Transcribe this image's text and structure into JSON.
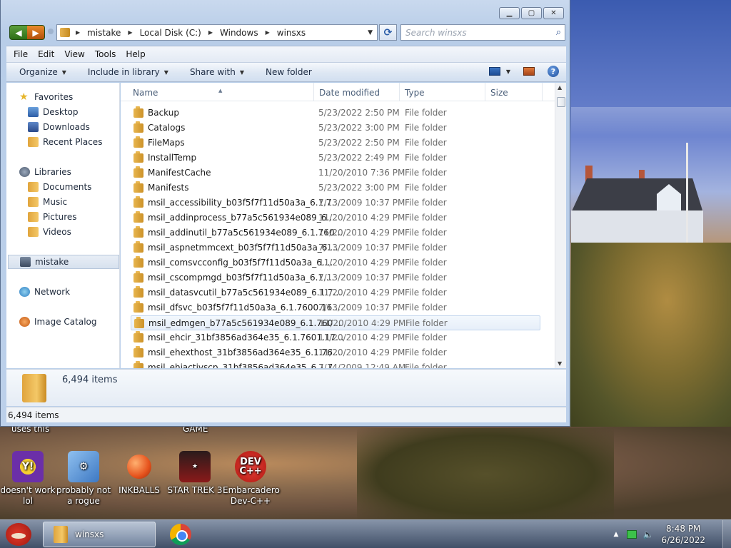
{
  "window": {
    "controls": {
      "minimize": "▭",
      "maximize": "▢",
      "close": "✕"
    }
  },
  "address_bar": {
    "crumbs": [
      "mistake",
      "Local Disk (C:)",
      "Windows",
      "winsxs"
    ]
  },
  "search": {
    "placeholder": "Search winsxs"
  },
  "menu": [
    "File",
    "Edit",
    "View",
    "Tools",
    "Help"
  ],
  "toolbar": {
    "organize": "Organize",
    "include_in_library": "Include in library",
    "share_with": "Share with",
    "new_folder": "New folder"
  },
  "navpane": {
    "favorites": "Favorites",
    "desktop": "Desktop",
    "downloads": "Downloads",
    "recent_places": "Recent Places",
    "libraries": "Libraries",
    "documents": "Documents",
    "music": "Music",
    "pictures": "Pictures",
    "videos": "Videos",
    "homegroup": "mistake",
    "network": "Network",
    "image_catalog": "Image Catalog"
  },
  "columns": {
    "name": "Name",
    "date_modified": "Date modified",
    "type": "Type",
    "size": "Size"
  },
  "files": [
    {
      "name": "Backup",
      "date": "5/23/2022 2:50 PM",
      "type": "File folder"
    },
    {
      "name": "Catalogs",
      "date": "5/23/2022 3:00 PM",
      "type": "File folder"
    },
    {
      "name": "FileMaps",
      "date": "5/23/2022 2:50 PM",
      "type": "File folder"
    },
    {
      "name": "InstallTemp",
      "date": "5/23/2022 2:49 PM",
      "type": "File folder"
    },
    {
      "name": "ManifestCache",
      "date": "11/20/2010 7:36 PM",
      "type": "File folder"
    },
    {
      "name": "Manifests",
      "date": "5/23/2022 3:00 PM",
      "type": "File folder"
    },
    {
      "name": "msil_accessibility_b03f5f7f11d50a3a_6.1.7...",
      "date": "7/13/2009 10:37 PM",
      "type": "File folder"
    },
    {
      "name": "msil_addinprocess_b77a5c561934e089_6....",
      "date": "11/20/2010 4:29 PM",
      "type": "File folder"
    },
    {
      "name": "msil_addinutil_b77a5c561934e089_6.1.760...",
      "date": "11/20/2010 4:29 PM",
      "type": "File folder"
    },
    {
      "name": "msil_aspnetmmcext_b03f5f7f11d50a3a_6....",
      "date": "7/13/2009 10:37 PM",
      "type": "File folder"
    },
    {
      "name": "msil_comsvcconfig_b03f5f7f11d50a3a_6....",
      "date": "11/20/2010 4:29 PM",
      "type": "File folder"
    },
    {
      "name": "msil_cscompmgd_b03f5f7f11d50a3a_6.1....",
      "date": "7/13/2009 10:37 PM",
      "type": "File folder"
    },
    {
      "name": "msil_datasvcutil_b77a5c561934e089_6.1.7...",
      "date": "11/20/2010 4:29 PM",
      "type": "File folder"
    },
    {
      "name": "msil_dfsvc_b03f5f7f11d50a3a_6.1.7600.16...",
      "date": "7/13/2009 10:37 PM",
      "type": "File folder"
    },
    {
      "name": "msil_edmgen_b77a5c561934e089_6.1.760...",
      "date": "11/20/2010 4:29 PM",
      "type": "File folder"
    },
    {
      "name": "msil_ehcir_31bf3856ad364e35_6.1.7601.17...",
      "date": "11/20/2010 4:29 PM",
      "type": "File folder"
    },
    {
      "name": "msil_ehexthost_31bf3856ad364e35_6.1.76...",
      "date": "11/20/2010 4:29 PM",
      "type": "File folder"
    },
    {
      "name": "msil_ehiactivscp_31bf3856ad364e35_6.1.7...",
      "date": "7/14/2009 12:49 AM",
      "type": "File folder"
    }
  ],
  "details": {
    "count": "6,494 items"
  },
  "status": {
    "count": "6,494 items"
  },
  "desktop": {
    "top_labels": [
      "uses this",
      "GAME"
    ],
    "icons": [
      {
        "label": "doesn't work lol",
        "icon": "yahoo-messenger-icon",
        "color": "#6b2fa8"
      },
      {
        "label": "probably not a rogue",
        "icon": "gears-icon",
        "color": "#4a86c8"
      },
      {
        "label": "INKBALLS",
        "icon": "inkball-icon",
        "color": "#e6531d"
      },
      {
        "label": "STAR TREK 3",
        "icon": "star-trek-icon",
        "color": "#8a1a1a"
      },
      {
        "label": "Embarcadero Dev-C++",
        "icon": "devcpp-icon",
        "color": "#d42a22"
      }
    ]
  },
  "taskbar": {
    "active_window": "winsxs",
    "time": "8:48 PM",
    "date": "6/26/2022"
  }
}
